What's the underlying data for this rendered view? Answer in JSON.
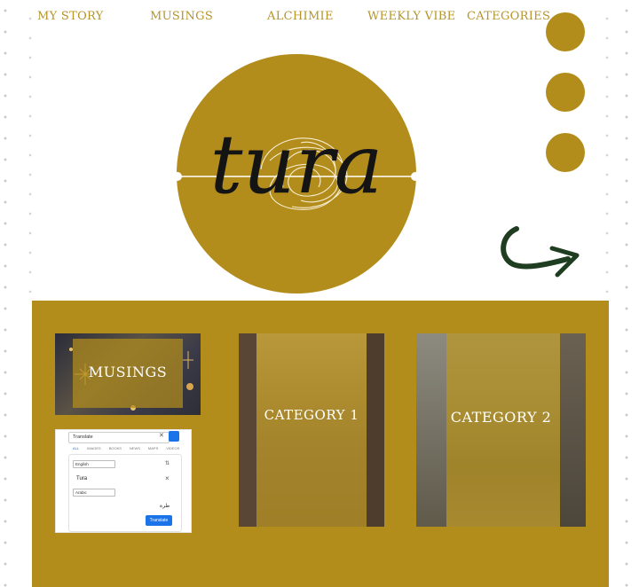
{
  "nav": {
    "items": [
      "MY STORY",
      "MUSINGS",
      "ALCHIMIE",
      "WEEKLY VIBE",
      "CATEGORIES"
    ]
  },
  "hero": {
    "logo_text": "tura"
  },
  "cards": {
    "musings": {
      "label": "MUSINGS"
    },
    "category1": {
      "label": "CATEGORY 1"
    },
    "category2": {
      "label": "CATEGORY 2"
    }
  },
  "translate": {
    "search_value": "Translate",
    "tabs": [
      "ALL",
      "IMAGES",
      "BOOKS",
      "NEWS",
      "MAPS",
      "VIDEOS"
    ],
    "source_lang": "English",
    "target_lang": "Arabic",
    "source_text": "Tura",
    "result_text": "طرة",
    "translate_label": "Translate"
  },
  "colors": {
    "accent": "#b38d1c",
    "nav_text": "#b5942a",
    "arrow": "#1f3d20"
  }
}
